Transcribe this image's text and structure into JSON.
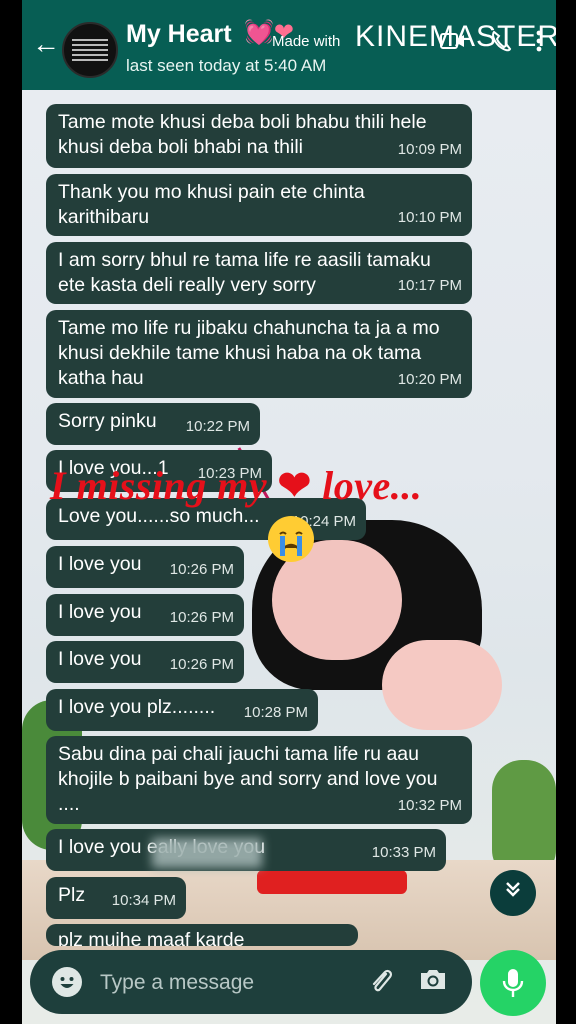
{
  "header": {
    "back_icon": "←",
    "name": "My Heart",
    "hearts": "💓❤",
    "status": "last seen today at 5:40 AM",
    "watermark_prefix": "Made with",
    "watermark_brand": "KINEMASTER",
    "icons": [
      "video-call-icon",
      "phone-icon",
      "more-icon"
    ]
  },
  "messages": [
    {
      "text": "Tame mote khusi deba boli bhabu thili hele khusi deba boli bhabi na thili",
      "time": "10:09 PM"
    },
    {
      "text": "Thank you mo khusi pain ete chinta karithibaru",
      "time": "10:10 PM"
    },
    {
      "text": "I am sorry bhul re tama life re aasili tamaku ete kasta deli really very sorry",
      "time": "10:17 PM"
    },
    {
      "text": "Tame mo life ru jibaku chahuncha ta ja a mo khusi dekhile tame khusi haba na ok tama katha hau",
      "time": "10:20 PM"
    },
    {
      "text": "Sorry pinku",
      "time": "10:22 PM"
    },
    {
      "text": "I love you...1",
      "time": "10:23 PM"
    },
    {
      "text": "Love you......so much...",
      "time": "10:24 PM"
    },
    {
      "text": "I love you",
      "time": "10:26 PM"
    },
    {
      "text": "I love you",
      "time": "10:26 PM"
    },
    {
      "text": "I love you",
      "time": "10:26 PM"
    },
    {
      "text": "I love you plz........",
      "time": "10:28 PM"
    },
    {
      "text": "Sabu dina pai chali jauchi tama life ru aau khojile b paibani bye and sorry and love you ....",
      "time": "10:32 PM"
    },
    {
      "text": "I love you            eally love you",
      "time": "10:33 PM"
    },
    {
      "text": "Plz",
      "time": "10:34 PM"
    },
    {
      "text": "plz muihe maaf karde",
      "time": ""
    }
  ],
  "overlay": {
    "text_before": "I missing my",
    "heart": "❤",
    "text_after": "love..."
  },
  "input": {
    "placeholder": "Type a message"
  },
  "icons": {
    "emoji": "emoji-icon",
    "attach": "paperclip-icon",
    "camera": "camera-icon",
    "mic": "microphone-icon",
    "scroll": "chevron-double-down-icon"
  }
}
